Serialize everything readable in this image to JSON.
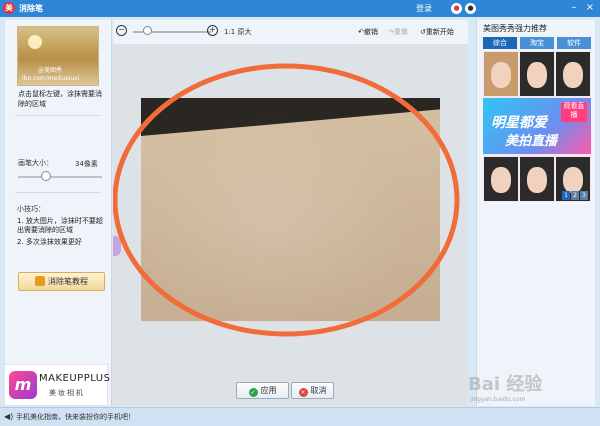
{
  "app": {
    "title": "消除笔",
    "login": "登录"
  },
  "left": {
    "thumb_watermark": "lbo.com/meituxiuxi",
    "thumb_tag": "@美图秀",
    "hint": "点击鼠标左键，涂抹需要消除的区域",
    "brush_label": "画笔大小：",
    "brush_value": "34像素",
    "brush_level": 0.3,
    "tips_title": "小技巧：",
    "tip1": "1. 放大图片，涂抹时不要超出需要消除的区域",
    "tip2": "2. 多次涂抹效果更好",
    "tutorial": "消除笔教程"
  },
  "toolbar": {
    "orig": "1:1 原大",
    "undo": "撤销",
    "redo": "重做",
    "reset": "重新开始",
    "zoom_level": 0.12
  },
  "buttons": {
    "apply": "应用",
    "cancel": "取消"
  },
  "right": {
    "title": "美图秀秀强力推荐",
    "tabs": [
      "综合",
      "淘宝",
      "软件"
    ],
    "ad_line1": "明星都爱",
    "ad_line2": "美拍直播",
    "ad_badge": "观看直播",
    "pages": [
      "1",
      "2",
      "3"
    ]
  },
  "logo": {
    "brand": "MAKEUPPLUS",
    "sub": "美妆相机"
  },
  "status": {
    "text": "手机美化指南，快来装扮你的手机吧！"
  },
  "watermark": {
    "text": "Bai 经验",
    "sub": "jingyan.baidu.com"
  },
  "colors": {
    "titlebar": "#2f85d6",
    "annotation_circle": "#f26b3a"
  }
}
